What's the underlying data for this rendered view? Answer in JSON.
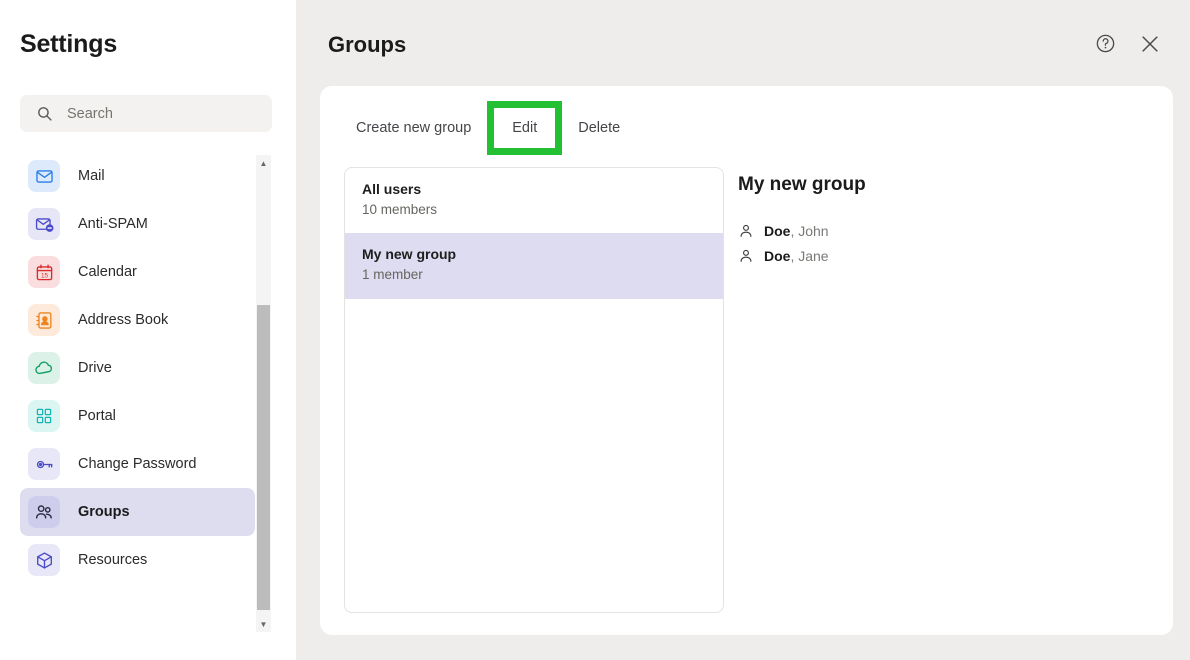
{
  "sidebar": {
    "title": "Settings",
    "search": {
      "placeholder": "Search",
      "value": "",
      "icon": "search-icon"
    },
    "items": [
      {
        "label": "Mail",
        "icon": "mail-icon",
        "icon_bg": "#dceafc",
        "icon_color": "#2b7de9",
        "selected": false
      },
      {
        "label": "Anti-SPAM",
        "icon": "anti-spam-icon",
        "icon_bg": "#e6e6f7",
        "icon_color": "#4b4bc8",
        "selected": false
      },
      {
        "label": "Calendar",
        "icon": "calendar-icon",
        "icon_bg": "#fadedf",
        "icon_color": "#d92b2b",
        "selected": false
      },
      {
        "label": "Address Book",
        "icon": "address-book-icon",
        "icon_bg": "#fdeada",
        "icon_color": "#ef8420",
        "selected": false
      },
      {
        "label": "Drive",
        "icon": "cloud-icon",
        "icon_bg": "#dcf2e8",
        "icon_color": "#14a06a",
        "selected": false
      },
      {
        "label": "Portal",
        "icon": "grid-icon",
        "icon_bg": "#dbf5f3",
        "icon_color": "#17b3b3",
        "selected": false
      },
      {
        "label": "Change Password",
        "icon": "key-icon",
        "icon_bg": "#e8e7f7",
        "icon_color": "#4b4bc8",
        "selected": false
      },
      {
        "label": "Groups",
        "icon": "people-icon",
        "icon_bg": "#cfcdec",
        "icon_color": "#2b2b40",
        "selected": true
      },
      {
        "label": "Resources",
        "icon": "cube-icon",
        "icon_bg": "#e8e7f7",
        "icon_color": "#4b4bc8",
        "selected": false
      }
    ],
    "scrollbar": {
      "up_arrow": "▲",
      "down_arrow": "▼"
    }
  },
  "header": {
    "title": "Groups",
    "help_icon": "help-circle-icon",
    "close_icon": "close-icon"
  },
  "tabs": [
    {
      "label": "Create new group",
      "highlighted": false
    },
    {
      "label": "Edit",
      "highlighted": true
    },
    {
      "label": "Delete",
      "highlighted": false
    }
  ],
  "highlight_color": "#22c032",
  "groups": [
    {
      "name": "All users",
      "members": "10 members",
      "selected": false
    },
    {
      "name": "My new group",
      "members": "1 member",
      "selected": true
    }
  ],
  "detail": {
    "title": "My new group",
    "members": [
      {
        "last": "Doe",
        "first": ", John",
        "icon": "person-icon"
      },
      {
        "last": "Doe",
        "first": ", Jane",
        "icon": "person-icon"
      }
    ]
  }
}
